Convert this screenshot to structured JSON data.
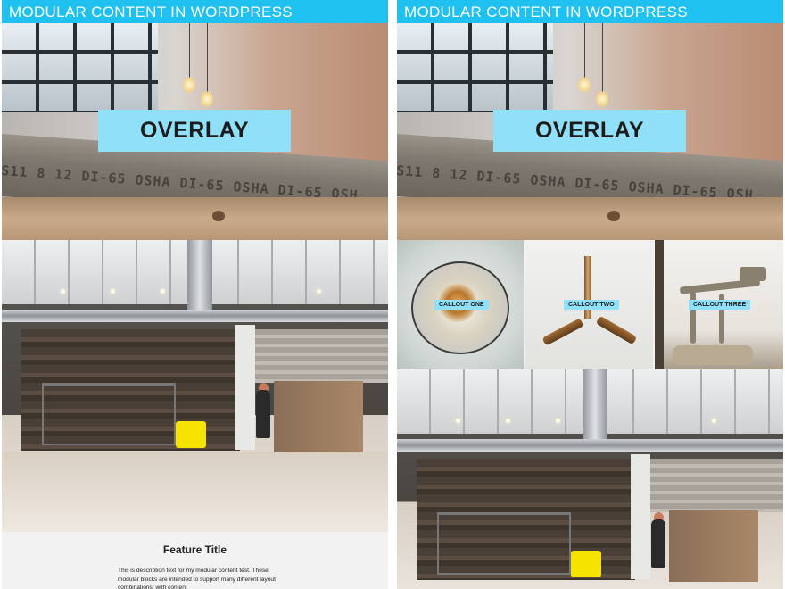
{
  "left": {
    "header_title": "MODULAR CONTENT IN WORDPRESS",
    "hero": {
      "overlay_label": "OVERLAY",
      "beam_stamp": "S11 8 12 DI-65 OSHA DI-65 OSHA DI-65 OSH"
    },
    "feature": {
      "title": "Feature Title",
      "description": "This is description text for my modular content test. These modular blocks are intended to support many different layout combinations, with content"
    }
  },
  "right": {
    "header_title": "MODULAR CONTENT IN WORDPRESS",
    "hero": {
      "overlay_label": "OVERLAY",
      "beam_stamp": "S11 8 12 DI-65 OSHA DI-65 OSHA DI-65 OSH"
    },
    "callouts": [
      {
        "label": "CALLOUT ONE"
      },
      {
        "label": "CALLOUT TWO"
      },
      {
        "label": "CALLOUT THREE"
      }
    ]
  },
  "colors": {
    "header_bar": "#1ec1ef",
    "overlay_box": "#8fe0f8",
    "callout_label": "#8fe0f8"
  }
}
